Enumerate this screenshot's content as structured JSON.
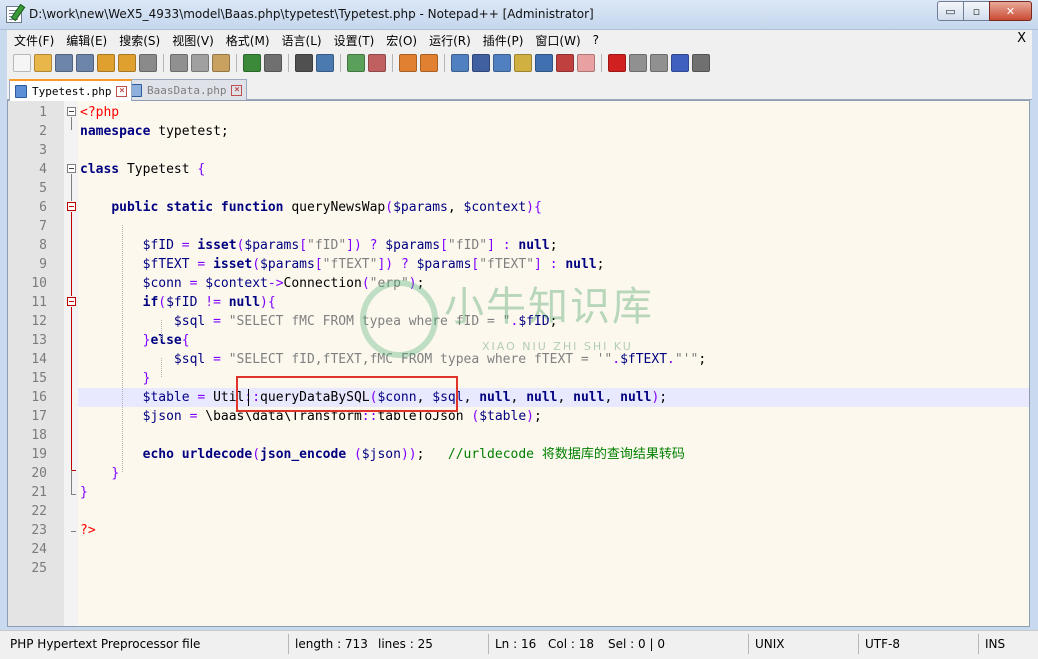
{
  "window": {
    "title": "D:\\work\\new\\WeX5_4933\\model\\Baas.php\\typetest\\Typetest.php - Notepad++ [Administrator]",
    "min_glyph": "▭",
    "max_glyph": "▫",
    "close_glyph": "✕"
  },
  "menu": {
    "items": [
      "文件(F)",
      "编辑(E)",
      "搜索(S)",
      "视图(V)",
      "格式(M)",
      "语言(L)",
      "设置(T)",
      "宏(O)",
      "运行(R)",
      "插件(P)",
      "窗口(W)",
      "?"
    ],
    "close_label": "X"
  },
  "toolbar": {
    "icons": [
      {
        "name": "new-file-icon",
        "color": "#f5f5f5"
      },
      {
        "name": "open-file-icon",
        "color": "#e9b64a"
      },
      {
        "name": "save-icon",
        "color": "#6d85a8"
      },
      {
        "name": "save-all-icon",
        "color": "#6d85a8"
      },
      {
        "name": "close-file-icon",
        "color": "#e0a030"
      },
      {
        "name": "close-all-icon",
        "color": "#e0a030"
      },
      {
        "name": "print-icon",
        "color": "#8a8a8a"
      },
      {
        "name": "sep"
      },
      {
        "name": "cut-icon",
        "color": "#909090"
      },
      {
        "name": "copy-icon",
        "color": "#a0a0a0"
      },
      {
        "name": "paste-icon",
        "color": "#c8a060"
      },
      {
        "name": "sep"
      },
      {
        "name": "undo-icon",
        "color": "#3a8a3a"
      },
      {
        "name": "redo-icon",
        "color": "#707070"
      },
      {
        "name": "sep"
      },
      {
        "name": "find-icon",
        "color": "#505050"
      },
      {
        "name": "replace-icon",
        "color": "#4a7ab0"
      },
      {
        "name": "sep"
      },
      {
        "name": "zoom-in-icon",
        "color": "#5aa05a"
      },
      {
        "name": "zoom-out-icon",
        "color": "#c06060"
      },
      {
        "name": "sep"
      },
      {
        "name": "sync-vertical-icon",
        "color": "#e08030"
      },
      {
        "name": "sync-horizontal-icon",
        "color": "#e08030"
      },
      {
        "name": "sep"
      },
      {
        "name": "word-wrap-icon",
        "color": "#5080c0"
      },
      {
        "name": "show-all-chars-icon",
        "color": "#4060a0"
      },
      {
        "name": "indent-guide-icon",
        "color": "#5080c0"
      },
      {
        "name": "user-language-icon",
        "color": "#d0b040"
      },
      {
        "name": "document-map-icon",
        "color": "#4070b0"
      },
      {
        "name": "function-list-icon",
        "color": "#c04040"
      },
      {
        "name": "folder-workspace-icon",
        "color": "#e8a0a0"
      },
      {
        "name": "sep"
      },
      {
        "name": "record-macro-icon",
        "color": "#d02020"
      },
      {
        "name": "stop-macro-icon",
        "color": "#909090"
      },
      {
        "name": "play-macro-icon",
        "color": "#909090"
      },
      {
        "name": "run-macro-multiple-icon",
        "color": "#4060c0"
      },
      {
        "name": "save-macro-icon",
        "color": "#707070"
      }
    ]
  },
  "tabs": [
    {
      "label": "Typetest.php",
      "active": true
    },
    {
      "label": "BaasData.php",
      "active": false
    }
  ],
  "editor": {
    "current_line": 16,
    "lines": [
      {
        "n": "1",
        "html": "<span class=\"php\">&lt;?php</span>"
      },
      {
        "n": "2",
        "html": "<span class=\"kw\">namespace</span> typetest;"
      },
      {
        "n": "3",
        "html": ""
      },
      {
        "n": "4",
        "html": "<span class=\"kw\">class</span> Typetest <span class=\"op\">{</span>"
      },
      {
        "n": "5",
        "html": ""
      },
      {
        "n": "6",
        "html": "    <span class=\"kw\">public static function</span> queryNewsWap<span class=\"op\">(</span><span class=\"var\">$params</span>, <span class=\"var\">$context</span><span class=\"op\">){</span>"
      },
      {
        "n": "7",
        "html": ""
      },
      {
        "n": "8",
        "html": "        <span class=\"var\">$fID</span> <span class=\"op\">=</span> <span class=\"kw\">isset</span><span class=\"op\">(</span><span class=\"var\">$params</span><span class=\"op\">[</span><span class=\"str\">\"fID\"</span><span class=\"op\">])</span> <span class=\"op\">?</span> <span class=\"var\">$params</span><span class=\"op\">[</span><span class=\"str\">\"fID\"</span><span class=\"op\">]</span> <span class=\"op\">:</span> <span class=\"kw\">null</span>;"
      },
      {
        "n": "9",
        "html": "        <span class=\"var\">$fTEXT</span> <span class=\"op\">=</span> <span class=\"kw\">isset</span><span class=\"op\">(</span><span class=\"var\">$params</span><span class=\"op\">[</span><span class=\"str\">\"fTEXT\"</span><span class=\"op\">])</span> <span class=\"op\">?</span> <span class=\"var\">$params</span><span class=\"op\">[</span><span class=\"str\">\"fTEXT\"</span><span class=\"op\">]</span> <span class=\"op\">:</span> <span class=\"kw\">null</span>;"
      },
      {
        "n": "10",
        "html": "        <span class=\"var\">$conn</span> <span class=\"op\">=</span> <span class=\"var\">$context</span><span class=\"op\">-&gt;</span>Connection<span class=\"op\">(</span><span class=\"str\">\"erp\"</span><span class=\"op\">)</span>;"
      },
      {
        "n": "11",
        "html": "        <span class=\"kw\">if</span><span class=\"op\">(</span><span class=\"var\">$fID</span> <span class=\"op\">!=</span> <span class=\"kw\">null</span><span class=\"op\">){</span>"
      },
      {
        "n": "12",
        "html": "            <span class=\"var\">$sql</span> <span class=\"op\">=</span> <span class=\"str\">\"SELECT fMC FROM typea where fID = \"</span><span class=\"op\">.</span><span class=\"var\">$fID</span>;"
      },
      {
        "n": "13",
        "html": "        <span class=\"op\">}</span><span class=\"kw\">else</span><span class=\"op\">{</span>"
      },
      {
        "n": "14",
        "html": "            <span class=\"var\">$sql</span> <span class=\"op\">=</span> <span class=\"str\">\"SELECT fID,fTEXT,fMC FROM typea where fTEXT = '\"</span><span class=\"op\">.</span><span class=\"var\">$fTEXT</span><span class=\"op\">.</span><span class=\"str\">\"'\"</span>;"
      },
      {
        "n": "15",
        "html": "        <span class=\"op\">}</span>"
      },
      {
        "n": "16",
        "html": "        <span class=\"var\">$table</span> <span class=\"op\">=</span> Util<span class=\"op\">::</span>queryDataBySQL<span class=\"op\">(</span><span class=\"var\">$conn</span>, <span class=\"var\">$sql</span>, <span class=\"kw\">null</span>, <span class=\"kw\">null</span>, <span class=\"kw\">null</span>, <span class=\"kw\">null</span><span class=\"op\">)</span>;"
      },
      {
        "n": "17",
        "html": "        <span class=\"var\">$json</span> <span class=\"op\">=</span> \\baas\\data\\Transform<span class=\"op\">::</span>tableToJson <span class=\"op\">(</span><span class=\"var\">$table</span><span class=\"op\">)</span>;"
      },
      {
        "n": "18",
        "html": ""
      },
      {
        "n": "19",
        "html": "        <span class=\"kw\">echo</span> <span class=\"kw\">urldecode</span><span class=\"op\">(</span><span class=\"kw\">json_encode</span> <span class=\"op\">(</span><span class=\"var\">$json</span><span class=\"op\">))</span>;   <span class=\"cmt\">//urldecode 将数据库的查询结果转码</span>"
      },
      {
        "n": "20",
        "html": "    <span class=\"op\">}</span>"
      },
      {
        "n": "21",
        "html": "<span class=\"op\">}</span>"
      },
      {
        "n": "22",
        "html": ""
      },
      {
        "n": "23",
        "html": "<span class=\"php\">?&gt;</span>"
      },
      {
        "n": "24",
        "html": ""
      },
      {
        "n": "25",
        "html": ""
      }
    ]
  },
  "watermark": {
    "main": "小牛知识库",
    "sub": "XIAO NIU ZHI SHI KU"
  },
  "status": {
    "file_type": "PHP Hypertext Preprocessor file",
    "length": "length : 713",
    "lines": "lines : 25",
    "ln": "Ln : 16",
    "col": "Col : 18",
    "sel": "Sel : 0 | 0",
    "eol": "UNIX",
    "encoding": "UTF-8",
    "mode": "INS"
  }
}
